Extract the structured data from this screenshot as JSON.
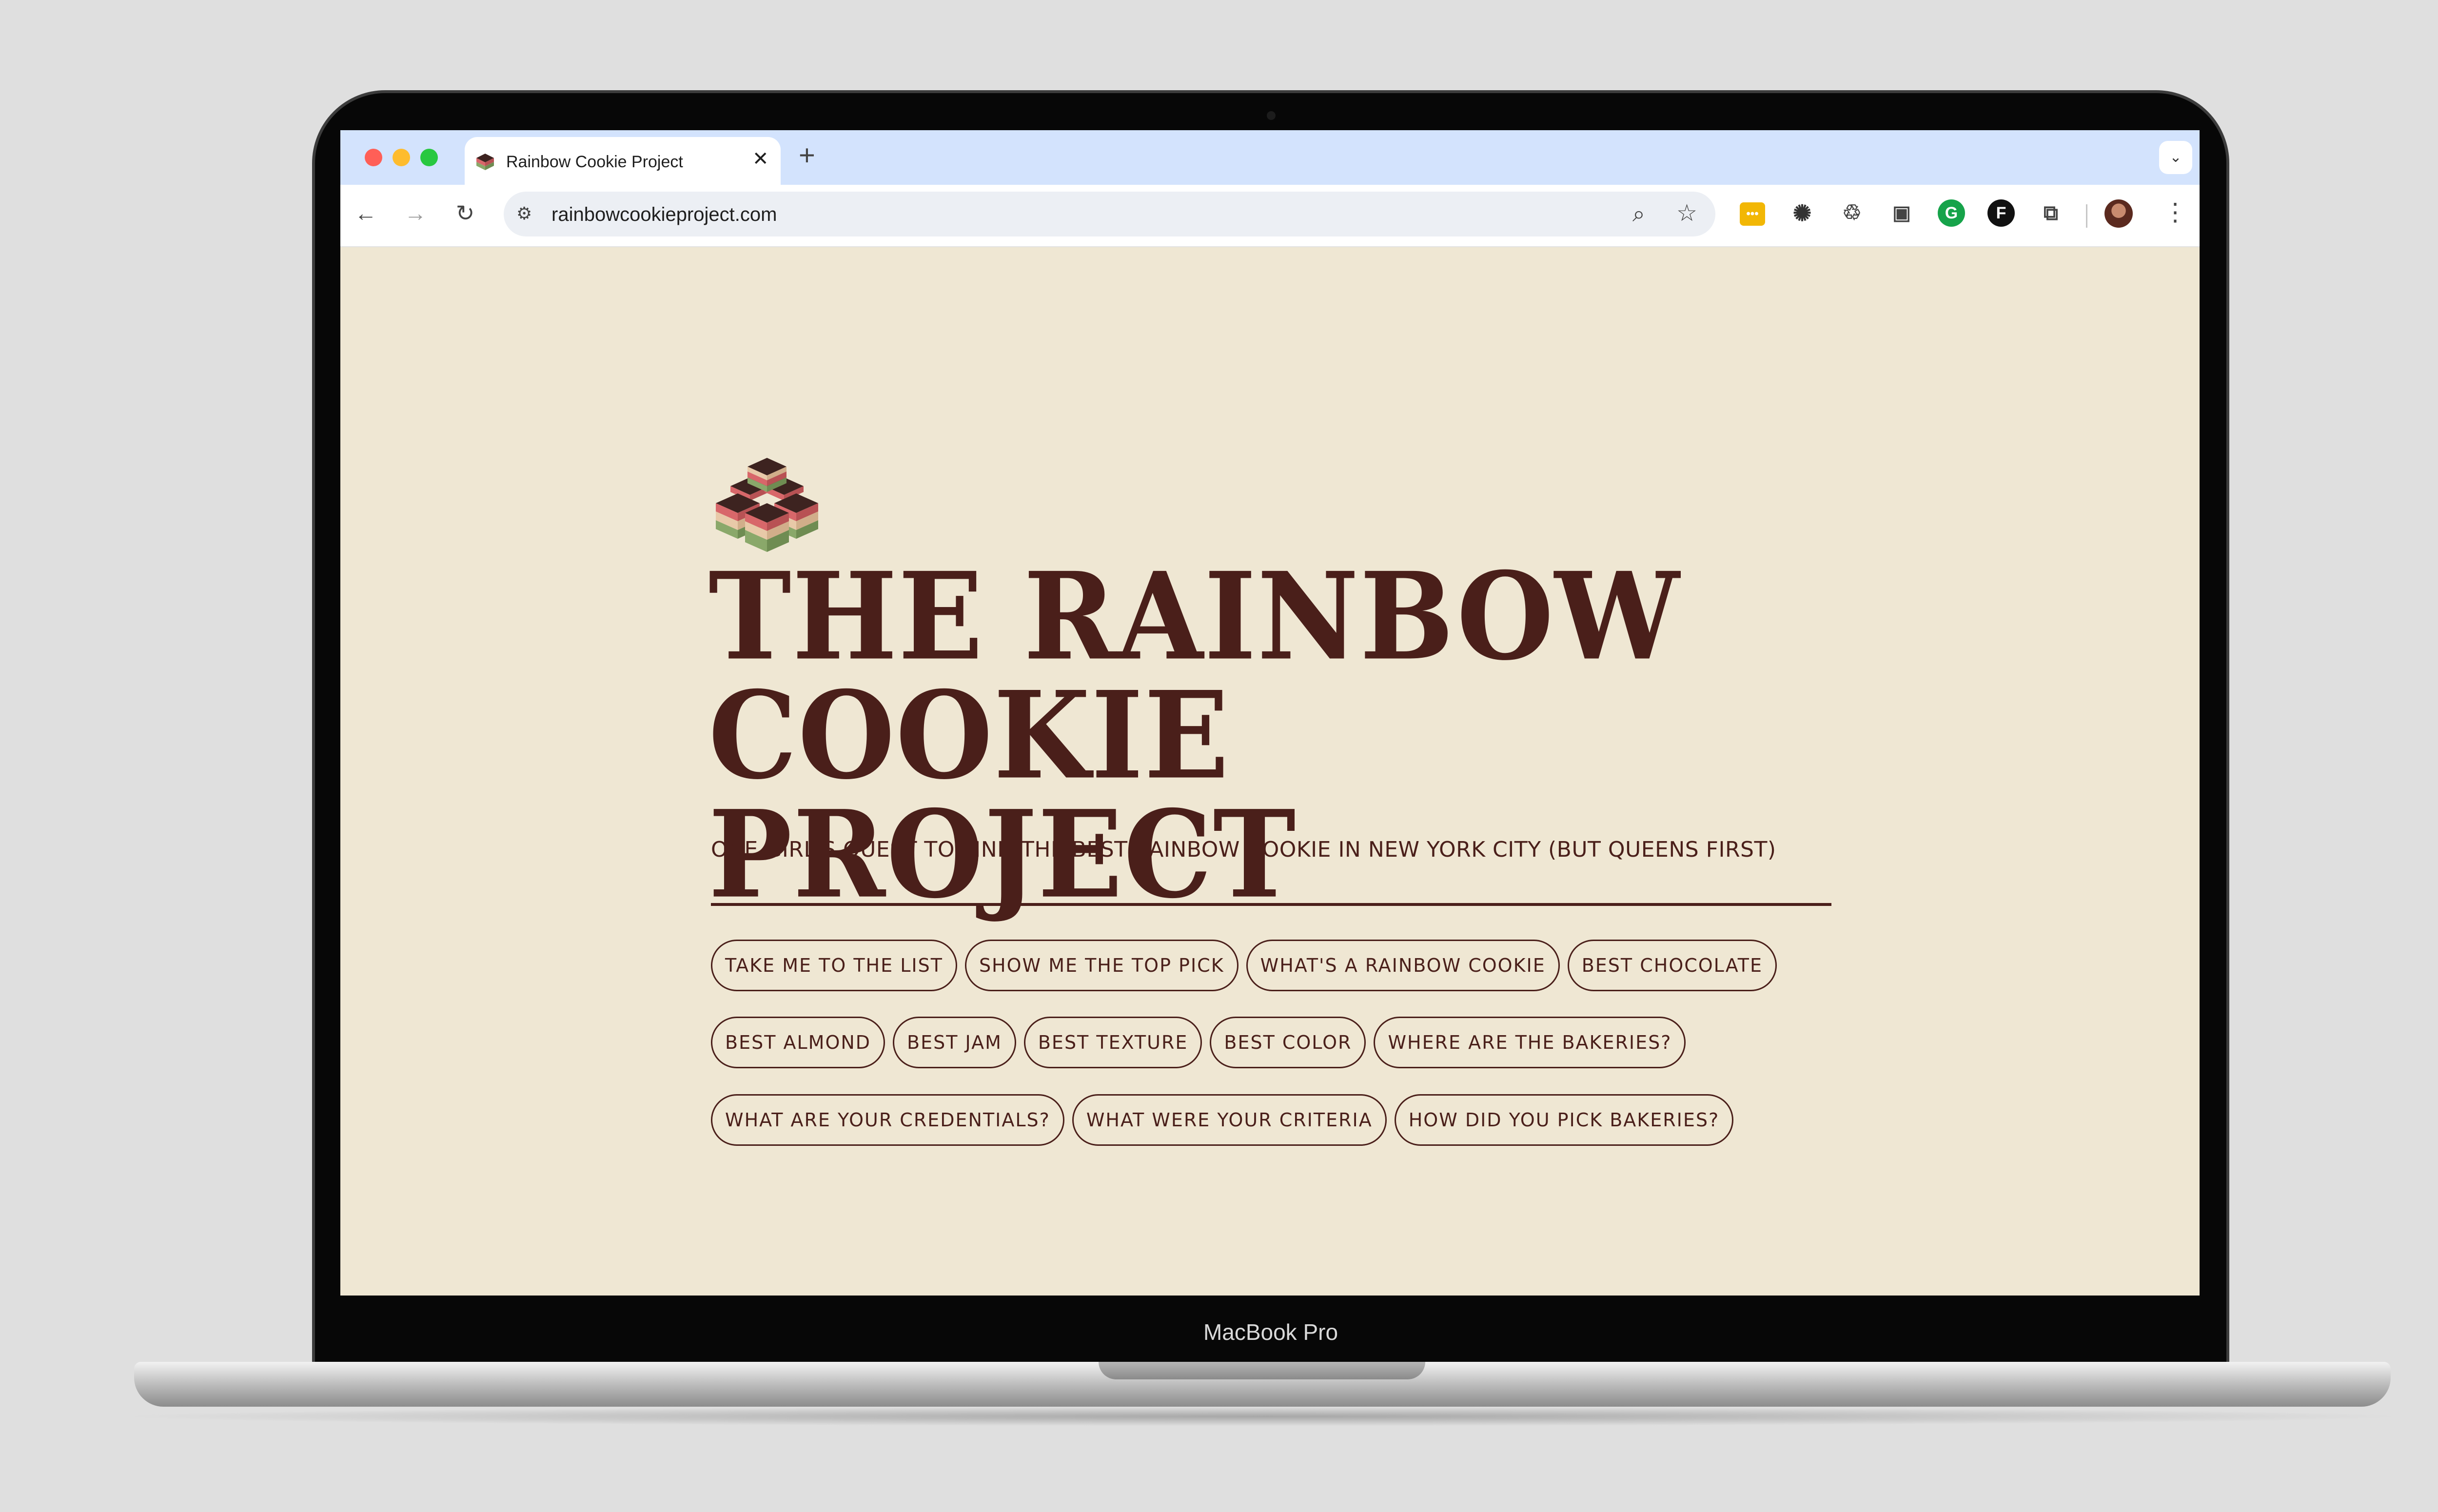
{
  "device": {
    "label": "MacBook Pro"
  },
  "browser": {
    "tab_title": "Rainbow Cookie Project",
    "tab_close_glyph": "✕",
    "new_tab_glyph": "+",
    "tab_search_glyph": "⌄",
    "url": "rainbowcookieproject.com",
    "nav": {
      "back": "←",
      "forward": "→",
      "reload": "↻"
    },
    "site_info_glyph": "⚙",
    "zoom_glyph": "⌕",
    "star_glyph": "☆",
    "menu_glyph": "⋮",
    "extensions": {
      "ext1": "•••",
      "ext2": "✺",
      "ext3": "♲",
      "ext4": "▣",
      "ext5": "G",
      "ext6": "F",
      "ext7": "⧉"
    }
  },
  "page": {
    "title_line1": "THE RAINBOW",
    "title_line2": "COOKIE PROJECT",
    "subtitle": "ONE GIRL'S QUEST TO FIND THE BEST RAINBOW COOKIE IN NEW YORK CITY (BUT QUEENS FIRST)",
    "links_row1": [
      "TAKE ME TO THE LIST",
      "SHOW ME THE TOP PICK",
      "WHAT'S A RAINBOW COOKIE",
      "BEST CHOCOLATE"
    ],
    "links_row2": [
      "BEST ALMOND",
      "BEST JAM",
      "BEST TEXTURE",
      "BEST COLOR",
      "WHERE ARE THE BAKERIES?"
    ],
    "links_row3": [
      "WHAT ARE YOUR CREDENTIALS?",
      "WHAT WERE YOUR CRITERIA",
      "HOW DID YOU PICK BAKERIES?"
    ]
  },
  "colors": {
    "page_background": "#efe7d3",
    "text_brown": "#4a1f1a",
    "tab_strip": "#d3e3fd",
    "cookie_red": "#d8676a",
    "cookie_green": "#8aa86a",
    "cookie_chocolate": "#3d2320"
  }
}
